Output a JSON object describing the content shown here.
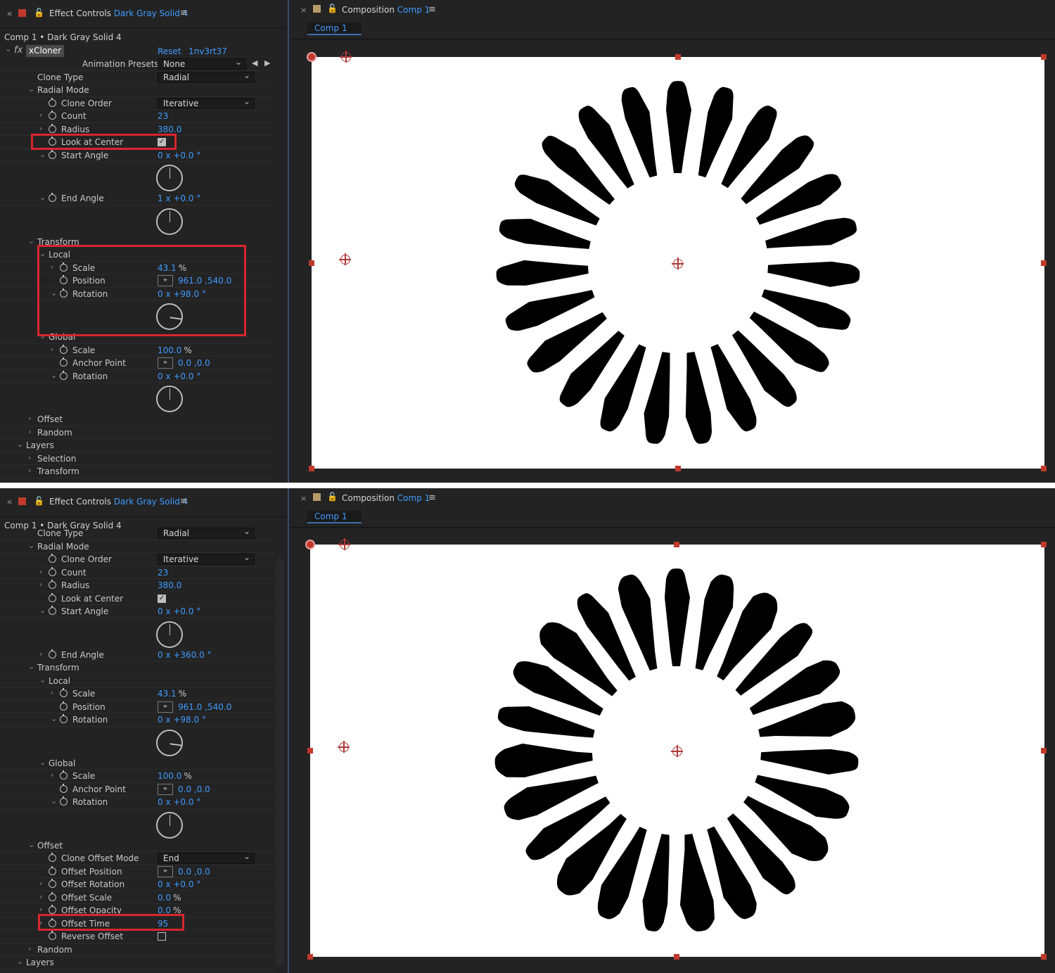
{
  "effect_controls": {
    "close": "×",
    "lock": "🔓",
    "title": "Effect Controls",
    "layer": "Dark Gray Solid 4",
    "menu": "≡",
    "subtitle": "Comp 1 • Dark Gray Solid 4"
  },
  "composition_panel": {
    "close": "×",
    "lock": "🔓",
    "title": "Composition",
    "comp_name": "Comp 1",
    "menu": "≡",
    "tab": "Comp 1"
  },
  "top": {
    "effect": {
      "fx": "fx",
      "name": "xCloner",
      "reset": "Reset",
      "code": "1nv3rt37"
    },
    "rows": [
      {
        "label": "Animation Presets:",
        "type": "preset",
        "value": "None"
      },
      {
        "label": "Clone Type",
        "type": "dropdown",
        "value": "Radial"
      },
      {
        "label": "Radial Mode",
        "type": "group",
        "arrow": "⌄"
      },
      {
        "label": "Clone Order",
        "type": "dropdown",
        "value": "Iterative",
        "sw": true
      },
      {
        "label": "Count",
        "type": "value",
        "value": "23",
        "sw": true,
        "arrow": "›"
      },
      {
        "label": "Radius",
        "type": "value",
        "value": "380.0",
        "sw": true,
        "arrow": "›"
      },
      {
        "label": "Look at Center",
        "type": "check",
        "value": "✓",
        "sw": true
      },
      {
        "label": "Start Angle",
        "type": "angle",
        "value": "0 x +0.0 °",
        "sw": true,
        "arrow": "⌄"
      },
      {
        "label": "End Angle",
        "type": "angle",
        "value": "1 x +0.0 °",
        "sw": true,
        "arrow": "⌄"
      },
      {
        "label": "Transform",
        "type": "group",
        "arrow": "⌄"
      },
      {
        "label": "Local",
        "type": "group",
        "arrow": "⌄"
      },
      {
        "label": "Scale",
        "type": "value",
        "value": "43.1",
        "unit": "%",
        "sw": true,
        "arrow": "›"
      },
      {
        "label": "Position",
        "type": "point",
        "value": "961.0 ,540.0",
        "sw": true
      },
      {
        "label": "Rotation",
        "type": "angle",
        "value": "0 x +98.0 °",
        "sw": true,
        "arrow": "⌄"
      },
      {
        "label": "Global",
        "type": "group",
        "arrow": "⌄"
      },
      {
        "label": "Scale",
        "type": "value",
        "value": "100.0",
        "unit": "%",
        "sw": true,
        "arrow": "›"
      },
      {
        "label": "Anchor Point",
        "type": "point",
        "value": "0.0 ,0.0",
        "sw": true
      },
      {
        "label": "Rotation",
        "type": "angle",
        "value": "0 x +0.0 °",
        "sw": true,
        "arrow": "⌄"
      },
      {
        "label": "Offset",
        "type": "group",
        "arrow": "›"
      },
      {
        "label": "Random",
        "type": "group",
        "arrow": "›"
      },
      {
        "label": "Layers",
        "type": "group",
        "arrow": "⌄"
      },
      {
        "label": "Selection",
        "type": "group",
        "arrow": "›"
      },
      {
        "label": "Transform",
        "type": "group",
        "arrow": "›"
      }
    ]
  },
  "bottom": {
    "rows": [
      {
        "label": "Clone Type",
        "type": "dropdown",
        "value": "Radial"
      },
      {
        "label": "Radial Mode",
        "type": "group",
        "arrow": "⌄"
      },
      {
        "label": "Clone Order",
        "type": "dropdown",
        "value": "Iterative",
        "sw": true
      },
      {
        "label": "Count",
        "type": "value",
        "value": "23",
        "sw": true,
        "arrow": "›"
      },
      {
        "label": "Radius",
        "type": "value",
        "value": "380.0",
        "sw": true,
        "arrow": "›"
      },
      {
        "label": "Look at Center",
        "type": "check",
        "value": "✓",
        "sw": true
      },
      {
        "label": "Start Angle",
        "type": "angle",
        "value": "0 x +0.0 °",
        "sw": true,
        "arrow": "⌄"
      },
      {
        "label": "End Angle",
        "type": "value",
        "value": "0 x +360.0 °",
        "sw": true,
        "arrow": "›"
      },
      {
        "label": "Transform",
        "type": "group",
        "arrow": "⌄"
      },
      {
        "label": "Local",
        "type": "group",
        "arrow": "⌄"
      },
      {
        "label": "Scale",
        "type": "value",
        "value": "43.1",
        "unit": "%",
        "sw": true,
        "arrow": "›"
      },
      {
        "label": "Position",
        "type": "point",
        "value": "961.0 ,540.0",
        "sw": true
      },
      {
        "label": "Rotation",
        "type": "angle",
        "value": "0 x +98.0 °",
        "sw": true,
        "arrow": "⌄"
      },
      {
        "label": "Global",
        "type": "group",
        "arrow": "⌄"
      },
      {
        "label": "Scale",
        "type": "value",
        "value": "100.0",
        "unit": "%",
        "sw": true,
        "arrow": "›"
      },
      {
        "label": "Anchor Point",
        "type": "point",
        "value": "0.0 ,0.0",
        "sw": true
      },
      {
        "label": "Rotation",
        "type": "angle",
        "value": "0 x +0.0 °",
        "sw": true,
        "arrow": "⌄"
      },
      {
        "label": "Offset",
        "type": "group",
        "arrow": "⌄"
      },
      {
        "label": "Clone Offset Mode",
        "type": "dropdown",
        "value": "End",
        "sw": true
      },
      {
        "label": "Offset Position",
        "type": "point",
        "value": "0.0 ,0.0",
        "sw": true
      },
      {
        "label": "Offset Rotation",
        "type": "value",
        "value": "0 x +0.0 °",
        "sw": true,
        "arrow": "›"
      },
      {
        "label": "Offset Scale",
        "type": "value",
        "value": "0.0",
        "unit": "%",
        "sw": true,
        "arrow": "›"
      },
      {
        "label": "Offset Opacity",
        "type": "value",
        "value": "0.0",
        "unit": "%",
        "sw": true,
        "arrow": "›"
      },
      {
        "label": "Offset Time",
        "type": "value",
        "value": "95",
        "sw": true,
        "arrow": "›"
      },
      {
        "label": "Reverse Offset",
        "type": "check-off",
        "value": "",
        "sw": true
      },
      {
        "label": "Random",
        "type": "group",
        "arrow": "›"
      },
      {
        "label": "Layers",
        "type": "group",
        "arrow": "⌄"
      }
    ]
  },
  "composition": {
    "clone_count": 23,
    "background": "#ffffff",
    "silhouette_color": "#000000"
  },
  "colors": {
    "accent": "#3f9bff",
    "highlight_box": "#d8262e",
    "panel_bg": "#232323"
  }
}
